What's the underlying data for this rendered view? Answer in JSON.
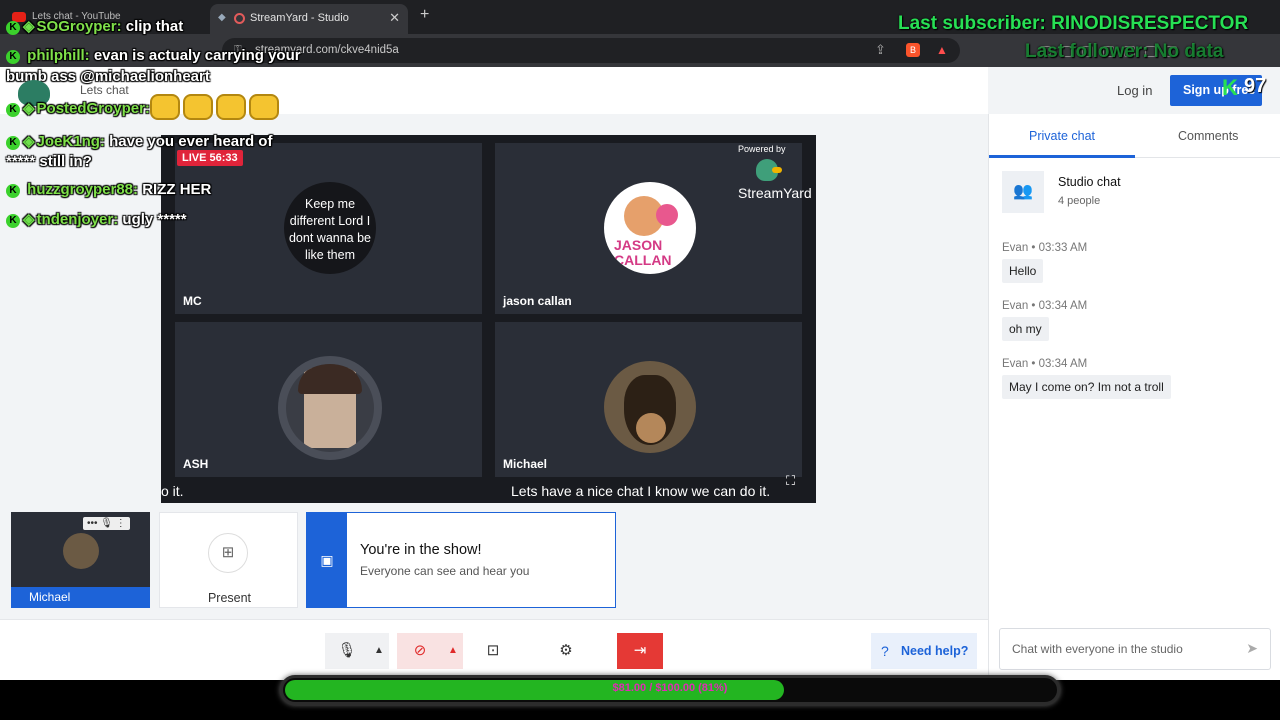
{
  "browser": {
    "inactive_tab": "Lets chat - YouTube",
    "active_tab": "StreamYard - Studio",
    "close_glyph": "✕",
    "new_tab_glyph": "+",
    "url": "streamyard.com/ckve4nid5a"
  },
  "header": {
    "room_title": "Lets chat",
    "login": "Log in",
    "signup": "Sign up free"
  },
  "stage": {
    "live_badge": "LIVE 56:33",
    "powered_by": "Powered by",
    "brand": "StreamYard",
    "tiles": [
      {
        "name": "MC",
        "avatar_text": "Keep me different Lord I dont wanna be like them"
      },
      {
        "name": "jason callan",
        "avatar_text": "JASON CALLAN"
      },
      {
        "name": "ASH"
      },
      {
        "name": "Michael"
      }
    ],
    "caption_left": "o it.",
    "caption_main": "Lets have a nice chat I know we can do it."
  },
  "bottom_row": {
    "self_name": "Michael",
    "present_label": "Present",
    "in_show_title": "You're in the show!",
    "in_show_sub": "Everyone can see and hear you"
  },
  "controls": {
    "help": "Need help?"
  },
  "chat": {
    "tab_private": "Private chat",
    "tab_comments": "Comments",
    "studio_title": "Studio chat",
    "studio_count": "4 people",
    "messages": [
      {
        "meta": "Evan  •  03:33 AM",
        "text": "Hello"
      },
      {
        "meta": "Evan  •  03:34 AM",
        "text": "oh my"
      },
      {
        "meta": "Evan  •  03:34 AM",
        "text": "May I come on? Im not a troll"
      }
    ],
    "input_placeholder": "Chat with everyone in the studio"
  },
  "overlay": {
    "top_line_1": "Last subscriber: RINODISRESPECTOR",
    "top_line_2": "Last follower: No data",
    "k_count": "97",
    "chat": [
      {
        "user": "SOGroyper:",
        "text": "clip that"
      },
      {
        "user": "philphill:",
        "text": "evan is actualy carrying your"
      },
      {
        "user": "",
        "text": "bumb ass @michaelionheart"
      },
      {
        "user": "PostedGroyper:",
        "text": ""
      },
      {
        "user": "JoeK1ng:",
        "text": "have you ever heard of"
      },
      {
        "user": "",
        "text": "***** still in?"
      },
      {
        "user": "huzzgroyper88:",
        "text": "RIZZ HER"
      },
      {
        "user": "tndenjoyer:",
        "text": "ugly *****"
      }
    ],
    "progress_text": "$81.00 / $100.00 (81%)",
    "progress_fraction": 0.81
  },
  "colors": {
    "accent": "#1d63d8",
    "live": "#e0243a",
    "overlay_green": "#27e054",
    "progress_green": "#23b521",
    "progress_text": "#e02bb6"
  }
}
